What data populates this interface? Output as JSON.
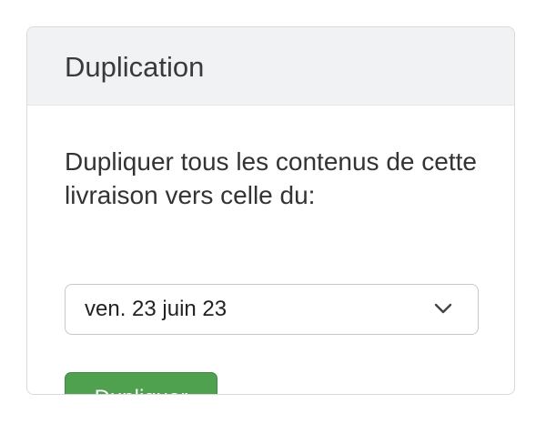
{
  "card": {
    "title": "Duplication",
    "description": "Dupliquer tous les contenus de cette livraison vers celle du:",
    "select": {
      "selected_value": "ven. 23 juin 23",
      "icon": "chevron-down-icon"
    },
    "button_label": "Dupliquer"
  },
  "colors": {
    "button_background": "#4fa04f",
    "header_background": "#f1f2f3"
  }
}
